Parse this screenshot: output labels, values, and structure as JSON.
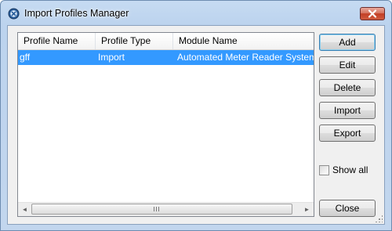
{
  "window": {
    "title": "Import Profiles Manager",
    "icon": "profiles-manager-icon",
    "close_icon": "close-icon"
  },
  "list": {
    "columns": [
      "Profile Name",
      "Profile Type",
      "Module Name"
    ],
    "rows": [
      {
        "profile_name": "gff",
        "profile_type": "Import",
        "module_name": "Automated Meter Reader System Re",
        "selected": true
      }
    ],
    "hscroll": {
      "left_arrow": "◄",
      "right_arrow": "►"
    }
  },
  "buttons": {
    "add": "Add",
    "edit": "Edit",
    "delete": "Delete",
    "import": "Import",
    "export": "Export",
    "close": "Close"
  },
  "show_all": {
    "label": "Show all",
    "checked": false
  },
  "colors": {
    "selection": "#3399ff",
    "title_gradient_top": "#c6dbf2",
    "close_button": "#c23e25"
  }
}
